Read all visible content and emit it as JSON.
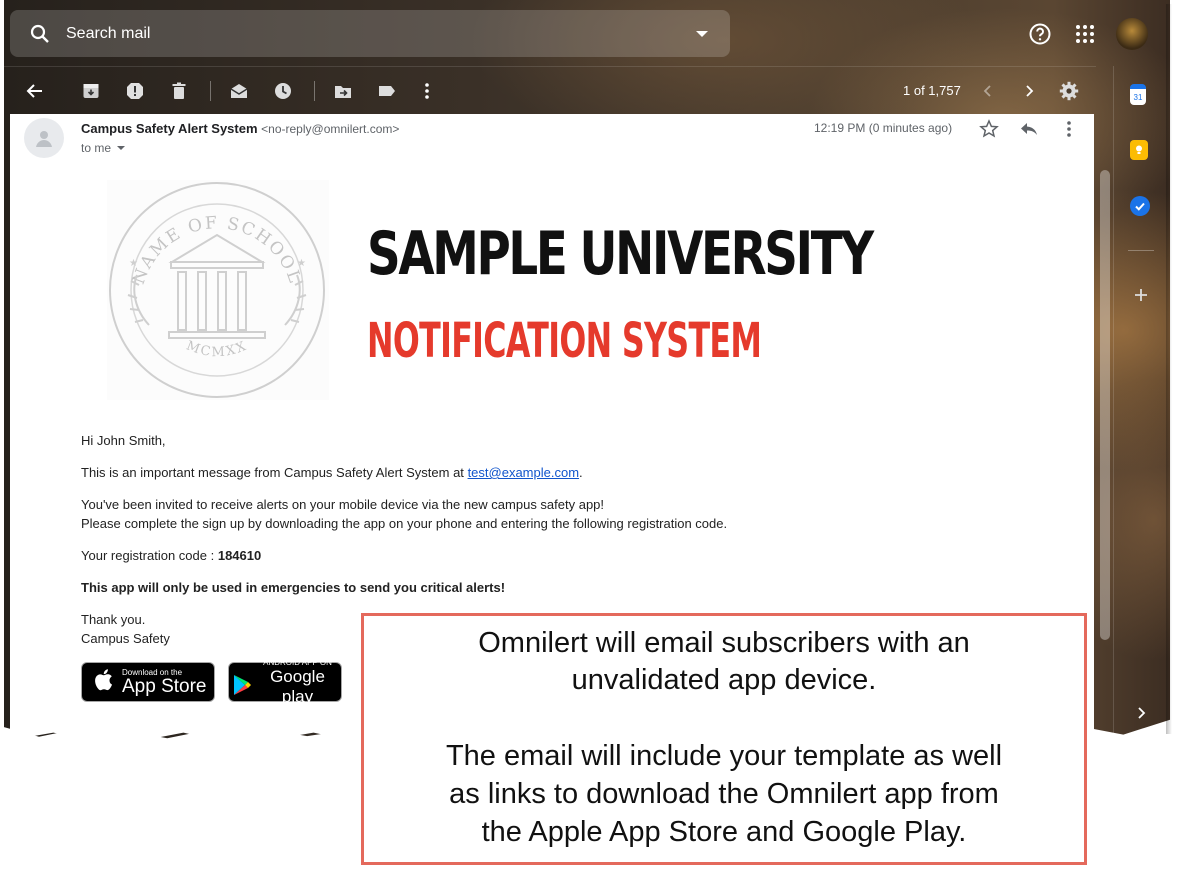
{
  "search": {
    "placeholder": "Search mail"
  },
  "toolbar": {
    "pager": "1 of 1,757"
  },
  "email": {
    "sender_name": "Campus Safety Alert System",
    "sender_address": "<no-reply@omnilert.com>",
    "to": "to me",
    "time": "12:19 PM (0 minutes ago)"
  },
  "banner": {
    "seal_top_text": "NAME OF SCHOOL",
    "seal_bottom_text": "MCMXX",
    "title": "SAMPLE UNIVERSITY",
    "subtitle": "NOTIFICATION SYSTEM",
    "title_color": "#111111",
    "subtitle_color": "#e53a2c"
  },
  "body": {
    "greeting": "Hi John Smith,",
    "intro": "This is an important message from Campus Safety Alert System at",
    "intro_link": "test@example.com",
    "intro_end": ".",
    "invite_line1": "You've been invited to receive alerts on your mobile device via the new campus safety app!",
    "invite_line2": "Please complete the sign up by downloading the app on your phone and entering the following registration code.",
    "code_label": "Your registration code :",
    "code_value": "184610",
    "warning": "This app will only be used in emergencies to send you critical alerts!",
    "signoff": "Thank you.",
    "signature": "Campus Safety"
  },
  "badges": {
    "appstore_small": "Download on the",
    "appstore_big": "App Store",
    "google_small": "ANDROID APP ON",
    "google_big": "Google play"
  },
  "sidepanel": {
    "calendar_day": "31"
  },
  "callout": {
    "line1": "Omnilert will email subscribers with an",
    "line2": "unvalidated app device.",
    "line3": "The email will include your template as well",
    "line4": "as links to download the Omnilert app from",
    "line5": "the Apple App Store and Google Play.",
    "border_color": "#e4695c"
  },
  "icons": [
    "search-icon",
    "dropdown-icon",
    "help-icon",
    "apps-icon",
    "back-icon",
    "archive-icon",
    "report-spam-icon",
    "delete-icon",
    "mark-unread-icon",
    "snooze-icon",
    "move-to-icon",
    "label-icon",
    "more-icon",
    "chevron-left-icon",
    "chevron-right-icon",
    "settings-icon",
    "star-icon",
    "reply-icon",
    "calendar-icon",
    "keep-icon",
    "tasks-icon",
    "add-icon",
    "expand-panel-icon",
    "avatar-icon",
    "apple-icon",
    "google-play-icon"
  ]
}
